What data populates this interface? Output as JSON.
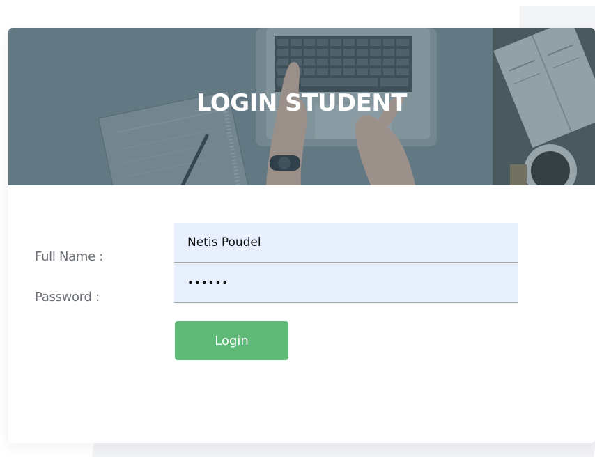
{
  "banner": {
    "title": "LOGIN STUDENT",
    "image": "laptop-desk-image"
  },
  "form": {
    "full_name_label": "Full Name :",
    "full_name_value": "Netis Poudel",
    "password_label": "Password :",
    "password_value": "secret",
    "login_label": "Login"
  },
  "colors": {
    "banner_tint": "#6a7e88",
    "input_bg": "#e8f0fe",
    "button": "#5fba78",
    "label_text": "#6b6f76"
  }
}
